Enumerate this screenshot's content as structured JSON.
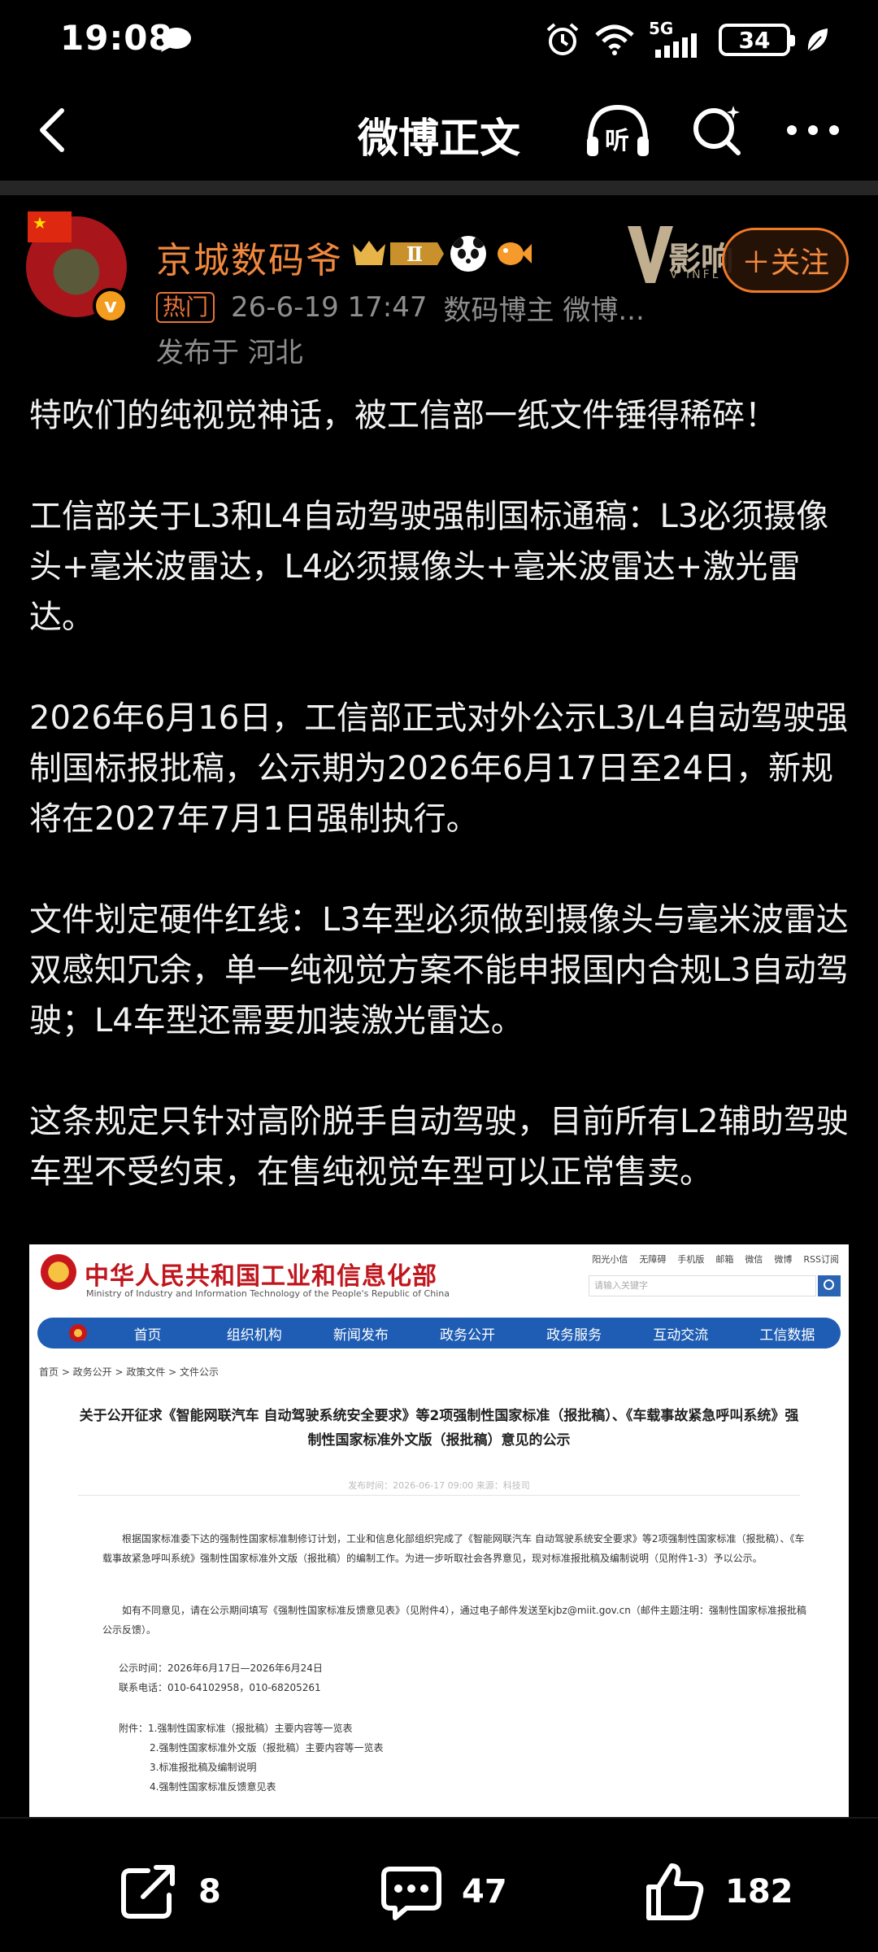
{
  "status_bar": {
    "time": "19:08",
    "network": "5G",
    "battery": "34"
  },
  "header": {
    "title": "微博正文",
    "listen_label": "听"
  },
  "author": {
    "name": "京城数码爷",
    "level": "Ⅱ",
    "verified_badge": "v",
    "v_badge_text": "影响",
    "v_badge_sub": "V INFL",
    "follow_label": "＋关注",
    "hot_label": "热门",
    "timestamp": "26-6-19 17:47",
    "source": "数码博主 微博...",
    "location": "发布于 河北"
  },
  "post": {
    "paragraphs": [
      "特吹们的纯视觉神话，被工信部一纸文件锤得稀碎！",
      "工信部关于L3和L4自动驾驶强制国标通稿：L3必须摄像头+毫米波雷达，L4必须摄像头+毫米波雷达+激光雷达。",
      "2026年6月16日，工信部正式对外公示L3/L4自动驾驶强制国标报批稿，公示期为2026年6月17日至24日，新规将在2027年7月1日强制执行。",
      "文件划定硬件红线：L3车型必须做到摄像头与毫米波雷达双感知冗余，单一纯视觉方案不能申报国内合规L3自动驾驶；L4车型还需要加装激光雷达。",
      "这条规定只针对高阶脱手自动驾驶，目前所有L2辅助驾驶车型不受约束，在售纯视觉车型可以正常售卖。"
    ]
  },
  "document_image": {
    "org_cn": "中华人民共和国工业和信息化部",
    "org_en": "Ministry of Industry and Information Technology of the People's Republic of China",
    "top_links": [
      "阳光小信",
      "无障碍",
      "手机版",
      "邮箱",
      "微信",
      "微博",
      "RSS订阅"
    ],
    "search_placeholder": "请输入关键字",
    "nav_items": [
      "首页",
      "组织机构",
      "新闻发布",
      "政务公开",
      "政务服务",
      "互动交流",
      "工信数据"
    ],
    "breadcrumb": "首页 > 政务公开 > 政策文件 > 文件公示",
    "title": "关于公开征求《智能网联汽车 自动驾驶系统安全要求》等2项强制性国家标准（报批稿）、《车载事故紧急呼叫系统》强制性国家标准外文版（报批稿）意见的公示",
    "meta": "发布时间：2026-06-17 09:00    来源：科技司",
    "para1": "根据国家标准委下达的强制性国家标准制修订计划，工业和信息化部组织完成了《智能网联汽车 自动驾驶系统安全要求》等2项强制性国家标准（报批稿）、《车载事故紧急呼叫系统》强制性国家标准外文版（报批稿）的编制工作。为进一步听取社会各界意见，现对标准报批稿及编制说明（见附件1-3）予以公示。",
    "para2": "如有不同意见，请在公示期间填写《强制性国家标准反馈意见表》（见附件4），通过电子邮件发送至kjbz@miit.gov.cn（邮件主题注明：强制性国家标准报批稿公示反馈）。",
    "period": "公示时间：2026年6月17日—2026年6月24日",
    "phone": "联系电话：010-64102958，010-68205261",
    "attachments": [
      "附件：1.强制性国家标准（报批稿）主要内容等一览表",
      "2.强制性国家标准外文版（报批稿）主要内容等一览表",
      "3.标准报批稿及编制说明",
      "4.强制性国家标准反馈意见表"
    ]
  },
  "actions": {
    "repost_count": "8",
    "comment_count": "47",
    "like_count": "182"
  }
}
